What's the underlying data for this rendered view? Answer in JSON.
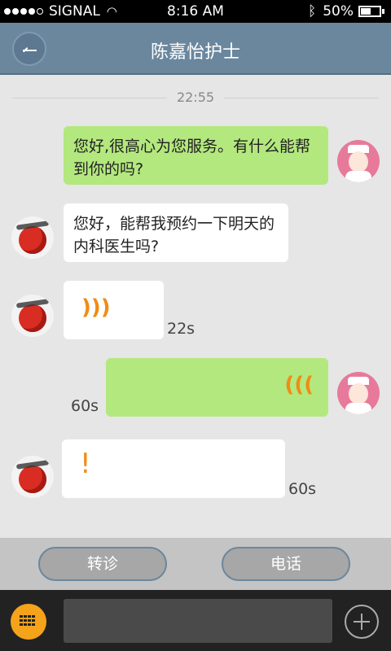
{
  "status_bar": {
    "carrier": "SIGNAL",
    "time": "8:16 AM",
    "battery": "50%",
    "battery_level": 0.5
  },
  "nav": {
    "title": "陈嘉怡护士"
  },
  "chat": {
    "timestamp": "22:55",
    "messages": [
      {
        "side": "right",
        "sender": "nurse",
        "type": "text",
        "text": "您好,很高心为您服务。有什么能帮到你的吗?"
      },
      {
        "side": "left",
        "sender": "patient",
        "type": "text",
        "text": "您好，能帮我预约一下明天的内科医生吗?"
      },
      {
        "side": "left",
        "sender": "patient",
        "type": "voice",
        "duration": "22s"
      },
      {
        "side": "right",
        "sender": "nurse",
        "type": "voice",
        "duration": "60s"
      },
      {
        "side": "left",
        "sender": "patient",
        "type": "voice-error",
        "symbol": "!",
        "duration": "60s"
      }
    ]
  },
  "actions": {
    "transfer": "转诊",
    "phone": "电话"
  },
  "input": {
    "value": "",
    "placeholder": ""
  },
  "colors": {
    "nav_bar": "#6a879e",
    "bubble_green": "#b3e87e",
    "accent_orange": "#f08c16"
  }
}
